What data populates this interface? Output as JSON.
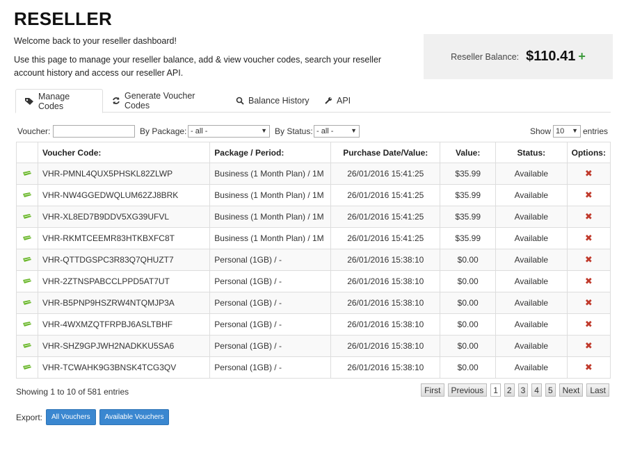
{
  "page": {
    "title": "RESELLER",
    "welcome": "Welcome back to your reseller dashboard!",
    "intro": "Use this page to manage your reseller balance, add & view voucher codes, search your reseller account history and access our reseller API."
  },
  "balance": {
    "label": "Reseller Balance:",
    "amount": "$110.41",
    "add": "+"
  },
  "tabs": [
    {
      "label": "Manage Codes",
      "icon": "tag-icon",
      "active": true
    },
    {
      "label": "Generate Voucher Codes",
      "icon": "refresh-icon"
    },
    {
      "label": "Balance History",
      "icon": "search-icon"
    },
    {
      "label": "API",
      "icon": "wrench-icon"
    }
  ],
  "filters": {
    "voucher_label": "Voucher:",
    "package_label": "By Package:",
    "package_value": "- all -",
    "status_label": "By Status:",
    "status_value": "- all -",
    "show_label": "Show",
    "show_value": "10",
    "entries_label": "entries"
  },
  "table": {
    "headers": [
      "",
      "Voucher Code:",
      "Package / Period:",
      "Purchase Date/Value:",
      "Value:",
      "Status:",
      "Options:"
    ],
    "rows": [
      {
        "code": "VHR-PMNL4QUX5PHSKL82ZLWP",
        "package": "Business (1 Month Plan) / 1M",
        "date": "26/01/2016 15:41:25",
        "value": "$35.99",
        "status": "Available"
      },
      {
        "code": "VHR-NW4GGEDWQLUM62ZJ8BRK",
        "package": "Business (1 Month Plan) / 1M",
        "date": "26/01/2016 15:41:25",
        "value": "$35.99",
        "status": "Available"
      },
      {
        "code": "VHR-XL8ED7B9DDV5XG39UFVL",
        "package": "Business (1 Month Plan) / 1M",
        "date": "26/01/2016 15:41:25",
        "value": "$35.99",
        "status": "Available"
      },
      {
        "code": "VHR-RKMTCEEMR83HTKBXFC8T",
        "package": "Business (1 Month Plan) / 1M",
        "date": "26/01/2016 15:41:25",
        "value": "$35.99",
        "status": "Available"
      },
      {
        "code": "VHR-QTTDGSPC3R83Q7QHUZT7",
        "package": "Personal (1GB) / -",
        "date": "26/01/2016 15:38:10",
        "value": "$0.00",
        "status": "Available"
      },
      {
        "code": "VHR-2ZTNSPABCCLPPD5AT7UT",
        "package": "Personal (1GB) / -",
        "date": "26/01/2016 15:38:10",
        "value": "$0.00",
        "status": "Available"
      },
      {
        "code": "VHR-B5PNP9HSZRW4NTQMJP3A",
        "package": "Personal (1GB) / -",
        "date": "26/01/2016 15:38:10",
        "value": "$0.00",
        "status": "Available"
      },
      {
        "code": "VHR-4WXMZQTFRPBJ6ASLTBHF",
        "package": "Personal (1GB) / -",
        "date": "26/01/2016 15:38:10",
        "value": "$0.00",
        "status": "Available"
      },
      {
        "code": "VHR-SHZ9GPJWH2NADKKU5SA6",
        "package": "Personal (1GB) / -",
        "date": "26/01/2016 15:38:10",
        "value": "$0.00",
        "status": "Available"
      },
      {
        "code": "VHR-TCWAHK9G3BNSK4TCG3QV",
        "package": "Personal (1GB) / -",
        "date": "26/01/2016 15:38:10",
        "value": "$0.00",
        "status": "Available"
      }
    ],
    "row_icon": "ticket-icon",
    "delete_icon": "delete-icon",
    "delete_glyph": "✖"
  },
  "info": "Showing 1 to 10 of 581 entries",
  "pagination": {
    "first": "First",
    "previous": "Previous",
    "pages": [
      "1",
      "2",
      "3",
      "4",
      "5"
    ],
    "current": "1",
    "next": "Next",
    "last": "Last"
  },
  "export": {
    "label": "Export:",
    "all": "All Vouchers",
    "available": "Available Vouchers"
  },
  "colors": {
    "accent": "#3a87d0",
    "plus": "#3c9a3c",
    "delete": "#c0392b",
    "ticket": "#6bb82c"
  }
}
